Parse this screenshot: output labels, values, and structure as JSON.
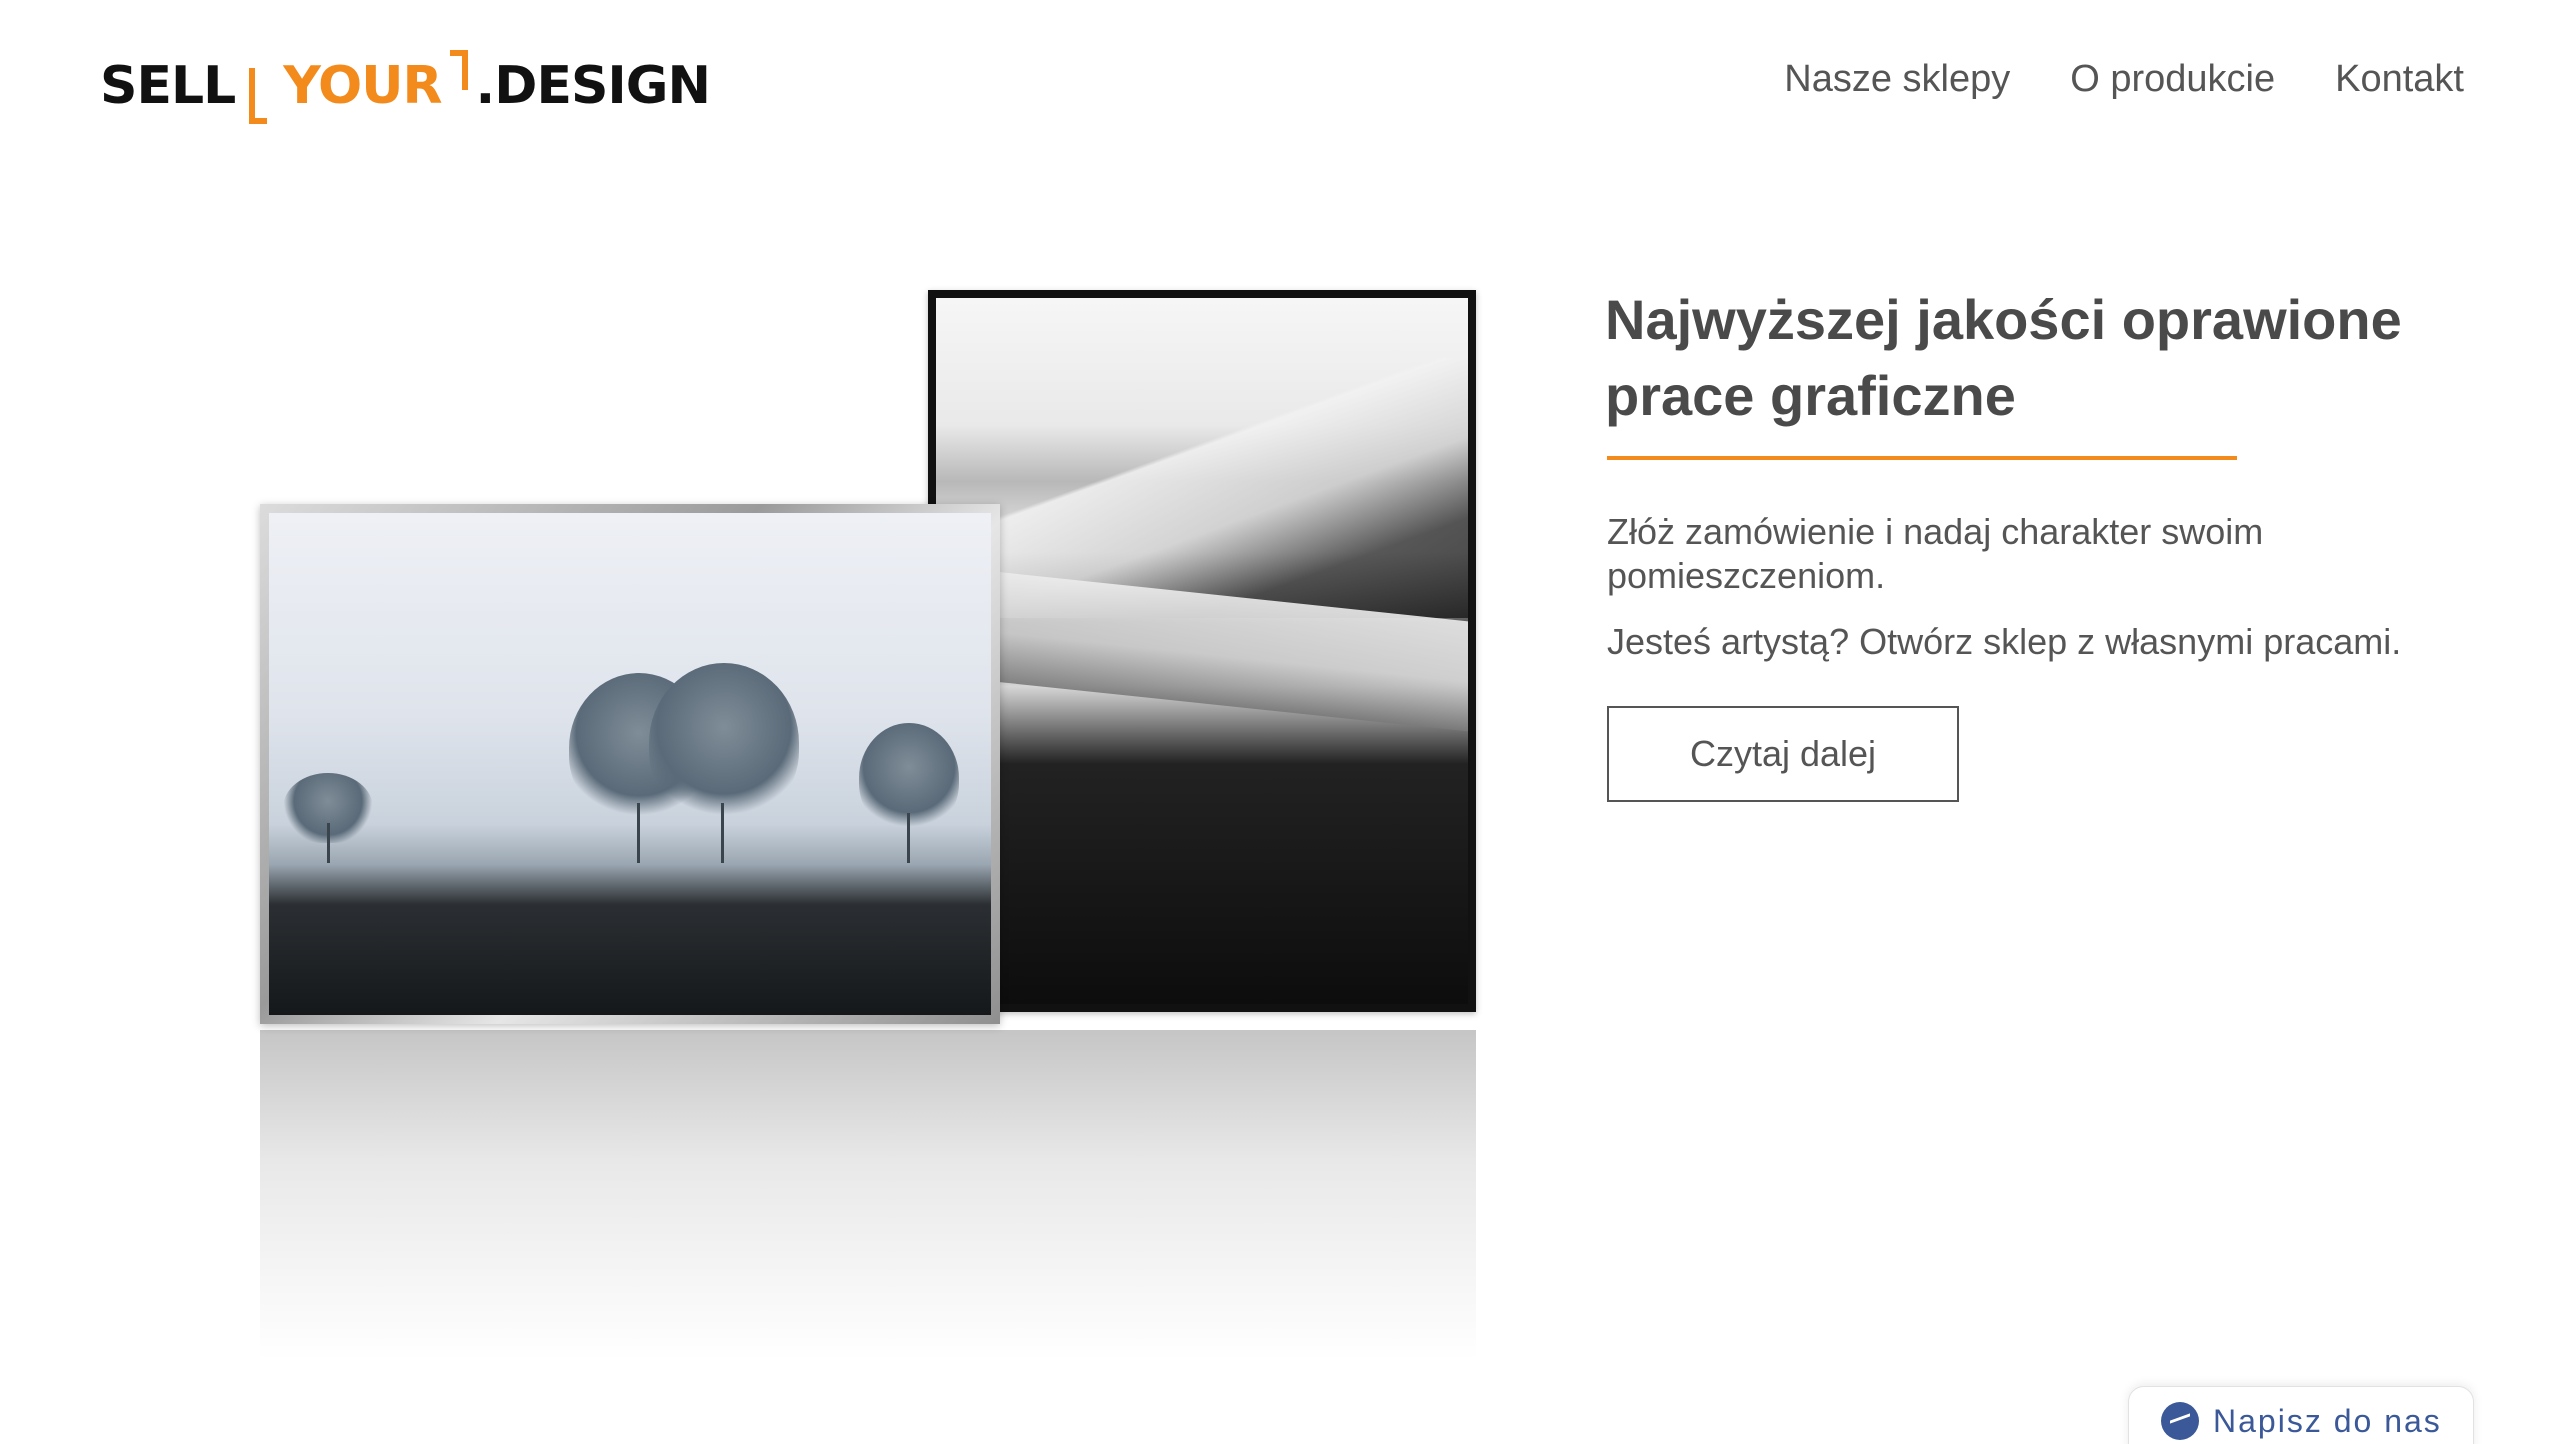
{
  "header": {
    "logo": {
      "part1": "SELL",
      "part2": "YOUR",
      "part3": ".DESIGN"
    },
    "nav": [
      {
        "label": "Nasze sklepy"
      },
      {
        "label": "O produkcie"
      },
      {
        "label": "Kontakt"
      }
    ]
  },
  "hero": {
    "headline": "Najwyższej jakości oprawione prace graficzne",
    "text1": "Złóż zamówienie i nadaj charakter swoim pomieszczeniom.",
    "text2": "Jesteś artystą? Otwórz sklep z własnymi pracami.",
    "button_label": "Czytaj dalej"
  },
  "chat": {
    "label": "Napisz do nas"
  },
  "colors": {
    "accent": "#f28a1c",
    "messenger": "#3b5998"
  }
}
